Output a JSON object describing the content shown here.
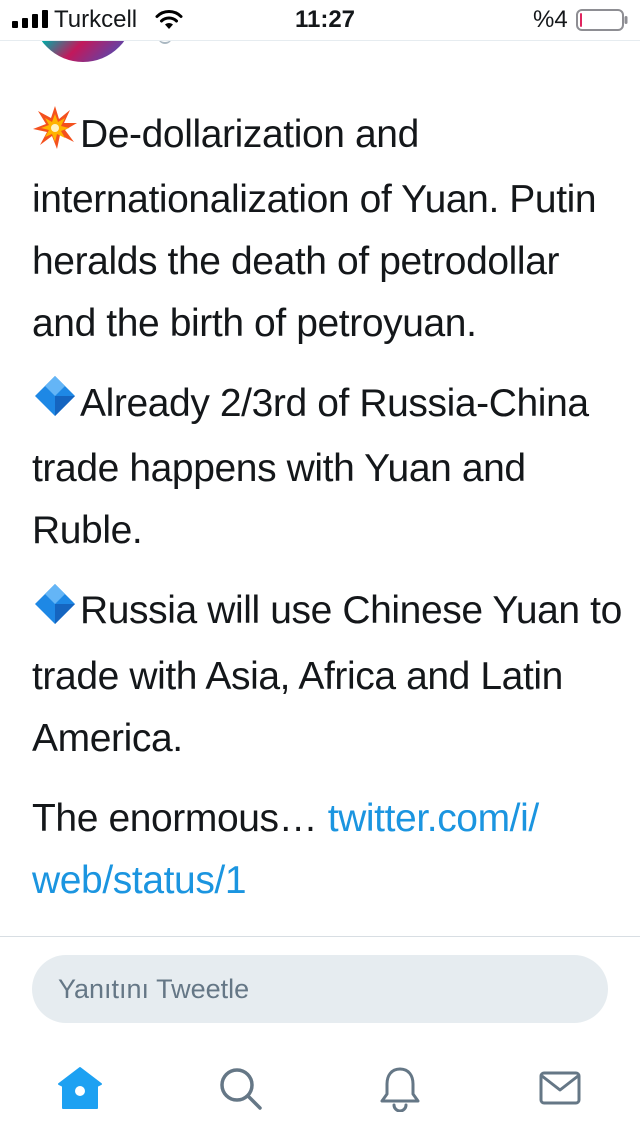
{
  "status_bar": {
    "carrier": "Turkcell",
    "time": "11:27",
    "battery_percent": "%4",
    "battery_level": 0.04,
    "icons": [
      "signal-icon",
      "wifi-icon",
      "battery-icon"
    ]
  },
  "tweet": {
    "paragraphs": [
      {
        "icon": "collision-emoji-icon",
        "text": "De-dollarization and internationalization of Yuan. Putin heralds the death of petrodollar and the birth of petroyuan."
      },
      {
        "icon": "blue-diamond-emoji-icon",
        "text": "Already 2/3rd of Russia-China trade happens with Yuan and Ruble."
      },
      {
        "icon": "blue-diamond-emoji-icon",
        "text": "Russia will use Chinese Yuan to trade with Asia, Africa and Latin America."
      }
    ],
    "truncated_text": "The enormous…",
    "link_line1": "twitter.com/i/",
    "link_line2": "web/status/1"
  },
  "reply": {
    "placeholder": "Yanıtını Tweetle"
  },
  "bottom_nav": {
    "items": [
      "home-icon",
      "search-icon",
      "notifications-icon",
      "messages-icon"
    ],
    "active": "home-icon"
  },
  "colors": {
    "link": "#1b95e0",
    "text": "#14171a",
    "muted": "#657786",
    "input_bg": "#e6ecf0",
    "battery_low": "#e0245e"
  }
}
